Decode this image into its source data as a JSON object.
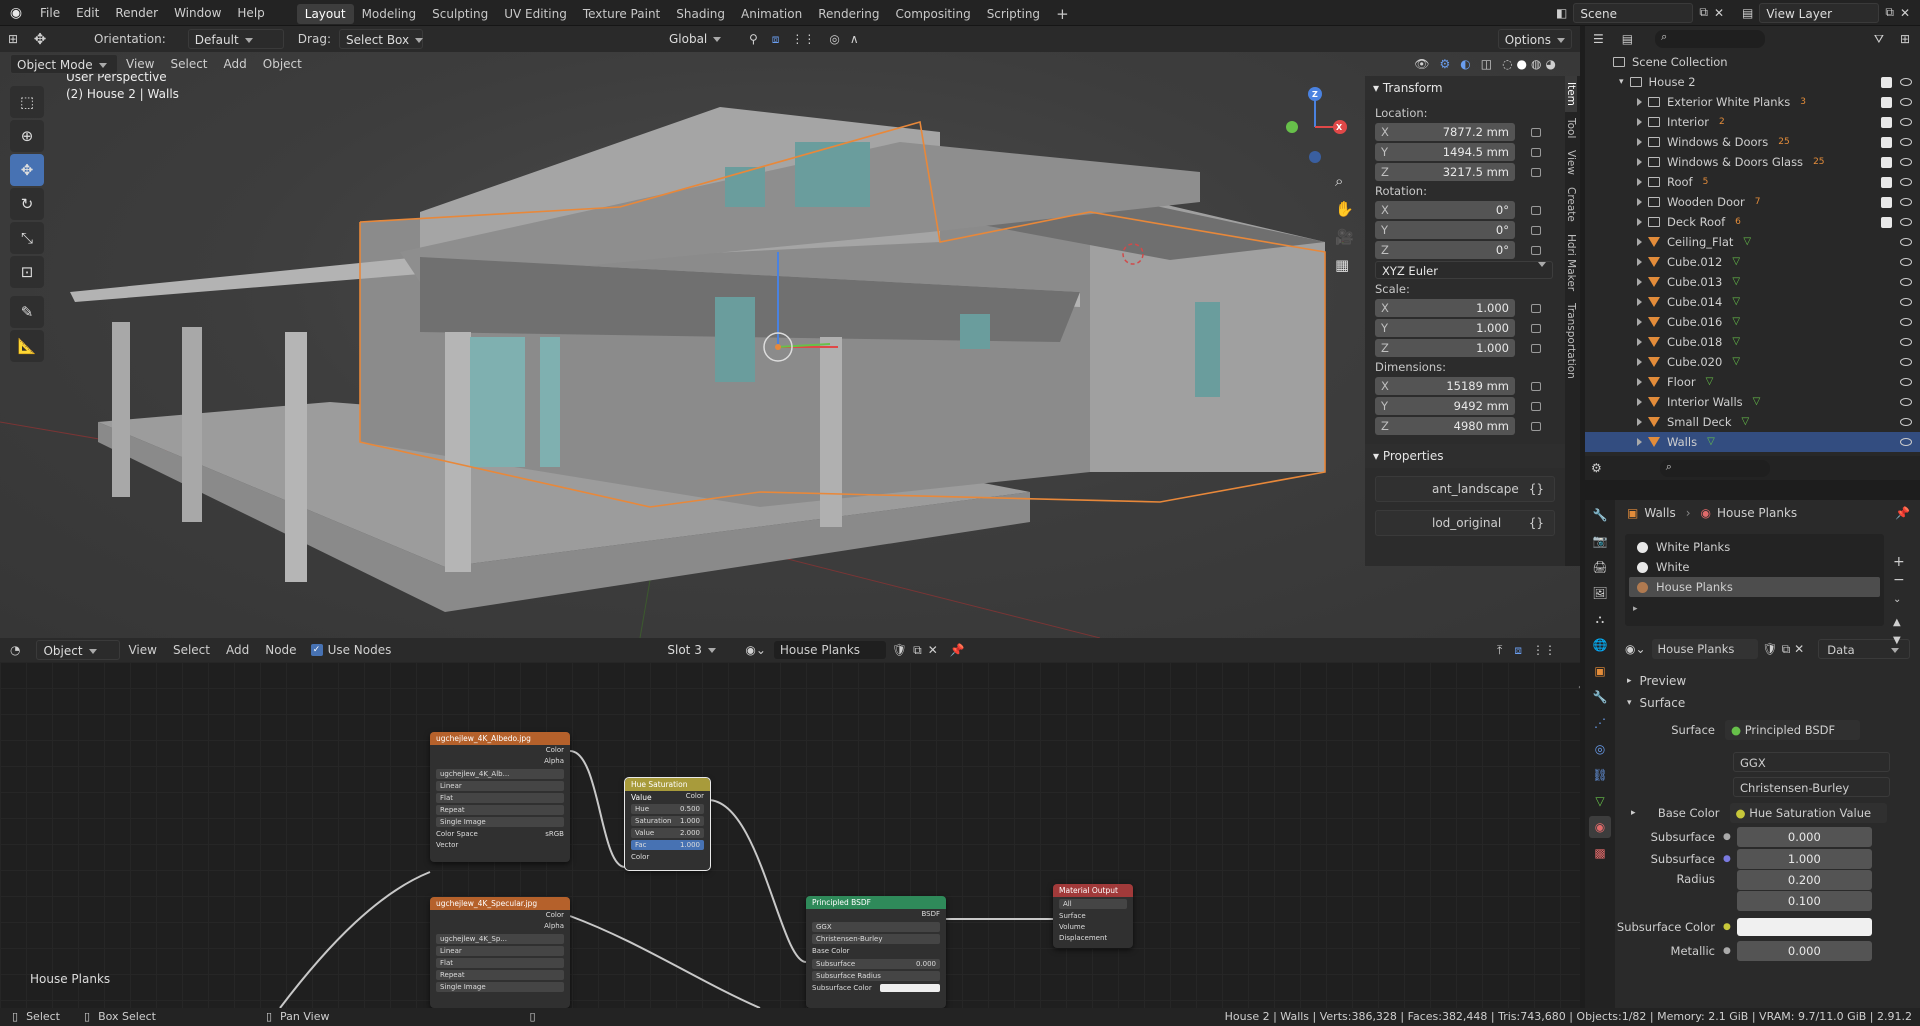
{
  "topmenu": {
    "items": [
      "File",
      "Edit",
      "Render",
      "Window",
      "Help"
    ]
  },
  "workspaces": [
    "Layout",
    "Modeling",
    "Sculpting",
    "UV Editing",
    "Texture Paint",
    "Shading",
    "Animation",
    "Rendering",
    "Compositing",
    "Scripting"
  ],
  "scene": {
    "name": "Scene",
    "view_layer": "View Layer"
  },
  "toolheader": {
    "orientation_label": "Orientation:",
    "orientation_value": "Default",
    "drag_label": "Drag:",
    "drag_value": "Select Box",
    "global": "Global",
    "options": "Options"
  },
  "viewport": {
    "mode": "Object Mode",
    "menu": [
      "View",
      "Select",
      "Add",
      "Object"
    ],
    "title": "User Perspective",
    "subtitle": "(2) House 2 | Walls"
  },
  "npanel": {
    "transform_title": "Transform",
    "location_label": "Location:",
    "loc": [
      {
        "k": "X",
        "v": "7877.2 mm"
      },
      {
        "k": "Y",
        "v": "1494.5 mm"
      },
      {
        "k": "Z",
        "v": "3217.5 mm"
      }
    ],
    "rotation_label": "Rotation:",
    "rot": [
      {
        "k": "X",
        "v": "0°"
      },
      {
        "k": "Y",
        "v": "0°"
      },
      {
        "k": "Z",
        "v": "0°"
      }
    ],
    "rotation_mode": "XYZ Euler",
    "scale_label": "Scale:",
    "scale": [
      {
        "k": "X",
        "v": "1.000"
      },
      {
        "k": "Y",
        "v": "1.000"
      },
      {
        "k": "Z",
        "v": "1.000"
      }
    ],
    "dimensions_label": "Dimensions:",
    "dim": [
      {
        "k": "X",
        "v": "15189 mm"
      },
      {
        "k": "Y",
        "v": "9492 mm"
      },
      {
        "k": "Z",
        "v": "4980 mm"
      }
    ],
    "properties_title": "Properties",
    "props": [
      {
        "name": "ant_landscape",
        "val": "{}"
      },
      {
        "name": "lod_original",
        "val": "{}"
      }
    ],
    "tabs": [
      "Item",
      "Tool",
      "View",
      "Create",
      "Hdri Maker",
      "Transportation"
    ]
  },
  "outliner": {
    "root": "Scene Collection",
    "collection": "House 2",
    "rows": [
      {
        "name": "Exterior White Planks",
        "badge": "3",
        "chk": true
      },
      {
        "name": "Interior",
        "badge": "2",
        "chk": true
      },
      {
        "name": "Windows & Doors",
        "badge": "25",
        "chk": true
      },
      {
        "name": "Windows & Doors Glass",
        "badge": "25",
        "chk": true
      },
      {
        "name": "Roof",
        "badge": "5",
        "chk": true
      },
      {
        "name": "Wooden Door",
        "badge": "7",
        "chk": true
      },
      {
        "name": "Deck Roof",
        "badge": "6",
        "chk": true
      },
      {
        "name": "Ceiling_Flat",
        "badge": "",
        "chk": false
      },
      {
        "name": "Cube.012",
        "badge": "",
        "chk": false
      },
      {
        "name": "Cube.013",
        "badge": "",
        "chk": false
      },
      {
        "name": "Cube.014",
        "badge": "",
        "chk": false
      },
      {
        "name": "Cube.016",
        "badge": "",
        "chk": false
      },
      {
        "name": "Cube.018",
        "badge": "",
        "chk": false
      },
      {
        "name": "Cube.020",
        "badge": "",
        "chk": false
      },
      {
        "name": "Floor",
        "badge": "",
        "chk": false
      },
      {
        "name": "Interior Walls",
        "badge": "",
        "chk": false
      },
      {
        "name": "Small Deck",
        "badge": "",
        "chk": false
      },
      {
        "name": "Walls",
        "badge": "",
        "chk": false
      }
    ]
  },
  "properties": {
    "breadcrumb_obj": "Walls",
    "breadcrumb_mat": "House Planks",
    "slots": [
      "White Planks",
      "White",
      "House Planks"
    ],
    "material_name": "House Planks",
    "data_dropdown": "Data",
    "preview": "Preview",
    "surface_section": "Surface",
    "surface_label": "Surface",
    "surface_value": "Principled BSDF",
    "dist": "GGX",
    "sss_method": "Christensen-Burley",
    "base_color_label": "Base Color",
    "base_color_value": "Hue Saturation Value",
    "subsurface_label": "Subsurface",
    "subsurface_value": "0.000",
    "ssr_label": "Subsurface Radius",
    "ssr": [
      "1.000",
      "0.200",
      "0.100"
    ],
    "ssc_label": "Subsurface Color",
    "metallic_label": "Metallic",
    "metallic_value": "0.000"
  },
  "nodeeditor": {
    "type": "Object",
    "menu": [
      "View",
      "Select",
      "Add",
      "Node"
    ],
    "use_nodes": "Use Nodes",
    "slot": "Slot 3",
    "material": "House Planks",
    "label": "House Planks",
    "albedo": {
      "title": "ugchejlew_4K_Albedo.jpg",
      "color": "Color",
      "alpha": "Alpha",
      "img": "ugchejlew_4K_Alb...",
      "opts": [
        "Linear",
        "Flat",
        "Repeat",
        "Single Image"
      ],
      "cs_label": "Color Space",
      "cs": "sRGB",
      "vector": "Vector"
    },
    "spec": {
      "title": "ugchejlew_4K_Specular.jpg",
      "color": "Color",
      "alpha": "Alpha",
      "img": "ugchejlew_4K_Sp...",
      "opts": [
        "Linear",
        "Flat",
        "Repeat",
        "Single Image"
      ]
    },
    "hsv": {
      "title": "Hue Saturation Value",
      "color_out": "Color",
      "rows": [
        {
          "k": "Hue",
          "v": "0.500"
        },
        {
          "k": "Saturation",
          "v": "1.000"
        },
        {
          "k": "Value",
          "v": "2.000"
        },
        {
          "k": "Fac",
          "v": "1.000"
        }
      ],
      "color_in": "Color"
    },
    "bsdf": {
      "title": "Principled BSDF",
      "out": "BSDF",
      "opts": [
        "GGX",
        "Christensen-Burley"
      ],
      "inputs": [
        "Base Color",
        "Subsurface",
        "Subsurface Radius",
        "Subsurface Color"
      ],
      "subsurface_v": "0.000"
    },
    "output": {
      "title": "Material Output",
      "target": "All",
      "inputs": [
        "Surface",
        "Volume",
        "Displacement"
      ]
    }
  },
  "status": {
    "select": "Select",
    "box_select": "Box Select",
    "pan_view": "Pan View",
    "stats": "House 2 | Walls | Verts:386,328 | Faces:382,448 | Tris:743,680 | Objects:1/82 | Memory: 2.1 GiB | VRAM: 9.7/11.0 GiB | 2.91.2"
  },
  "colors": {
    "accent": "#4772b3",
    "selection_outline": "#e8883a",
    "image_node": "#b5612b",
    "converter_node": "#a89b3b",
    "shader_node": "#2f8a5a",
    "output_node": "#a13a3a"
  }
}
